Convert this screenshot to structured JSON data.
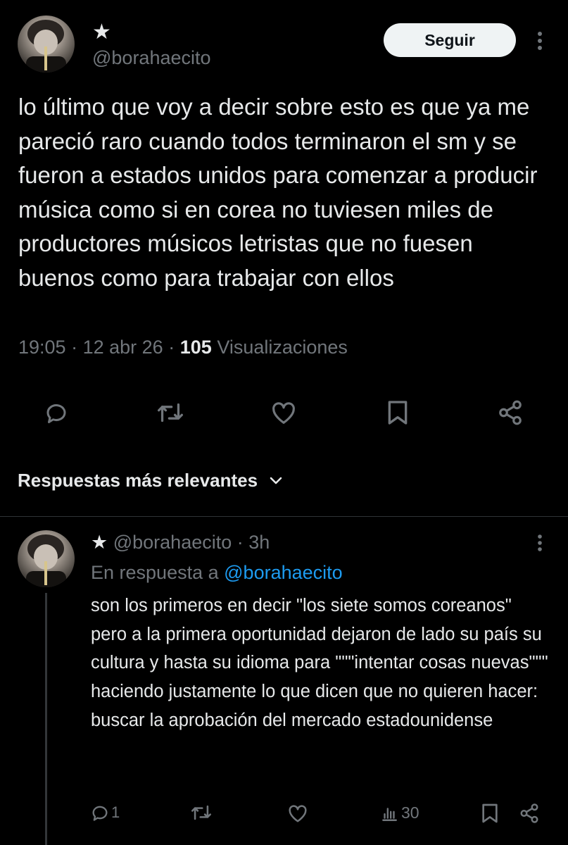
{
  "tweet": {
    "author_name": "★",
    "author_handle": "@borahaecito",
    "follow_label": "Seguir",
    "text": "lo último que voy a decir sobre esto es que ya me pareció raro cuando todos terminaron el sm y se fueron a estados unidos para comenzar a producir música como si en corea no tuviesen miles de productores músicos letristas que no fuesen buenos como para trabajar con ellos",
    "time": "19:05",
    "sep1": "·",
    "date": "12 abr 26",
    "sep2": "·",
    "views_count": "105",
    "views_label": "Visualizaciones"
  },
  "replies_filter": {
    "label": "Respuestas más relevantes"
  },
  "reply": {
    "author_name": "★",
    "author_handle": "@borahaecito",
    "sep": "·",
    "time": "3h",
    "in_reply_prefix": "En respuesta a",
    "in_reply_handle": "@borahaecito",
    "text": "son los primeros en decir \"los siete somos coreanos\" pero a la primera oportunidad dejaron de lado su país su cultura y hasta su idioma para \"\"\"intentar cosas nuevas\"\"\" haciendo justamente lo que dicen que no quieren hacer: buscar la aprobación del mercado estadounidense",
    "reply_count": "1",
    "views_count": "30"
  },
  "colors": {
    "link": "#1d9bf0",
    "muted": "#71767b",
    "text": "#e7e9ea",
    "background": "#000000"
  },
  "icons": [
    "reply-icon",
    "retweet-icon",
    "like-icon",
    "bookmark-icon",
    "share-icon",
    "more-icon",
    "chevron-down-icon",
    "views-icon"
  ]
}
